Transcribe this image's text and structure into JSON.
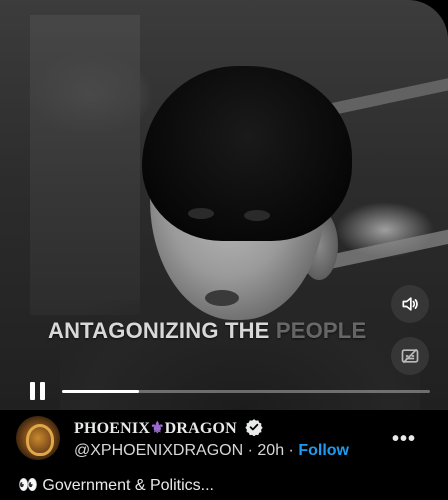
{
  "video": {
    "caption_main": "ANTAGONIZING THE ",
    "caption_faded": "PEOPLE",
    "progress": 0.21,
    "playing": true
  },
  "controls": {
    "volume_icon": "speaker-icon",
    "captions_icon": "captions-off-icon",
    "pause_icon": "pause-icon"
  },
  "author": {
    "name_left": "PHOENIX",
    "name_symbol": "⚜",
    "name_right": "DRAGON",
    "handle": "@XPHOENIXDRAGON",
    "separator": "·",
    "time": "20h",
    "follow_label": "Follow",
    "more_label": "•••"
  },
  "post": {
    "emoji": "👀",
    "text": "Government & Politics..."
  },
  "colors": {
    "accent": "#1d9bf0",
    "background": "#000000"
  }
}
